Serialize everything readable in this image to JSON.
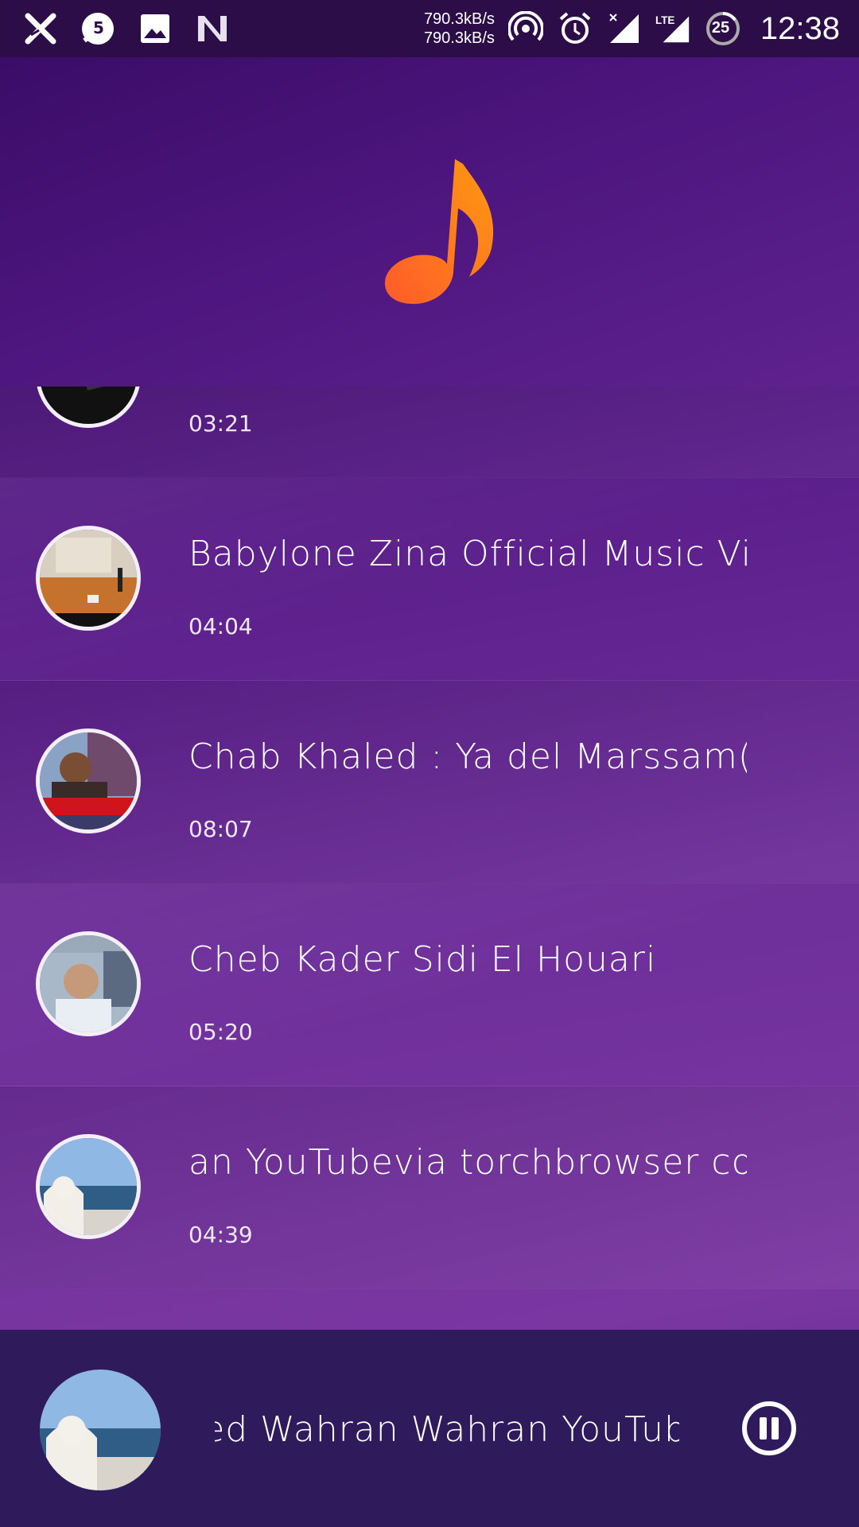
{
  "status_bar": {
    "net_up": "790.3kB/s",
    "net_down": "790.3kB/s",
    "notification_badge": "5",
    "battery_level": "25",
    "time": "12:38"
  },
  "tracks": [
    {
      "title": "",
      "duration": "03:21"
    },
    {
      "title": "Babylone Zina Official Music Vic",
      "duration": "04:04"
    },
    {
      "title": "Chab Khaled : Ya del Marssam(",
      "duration": "08:07"
    },
    {
      "title": "Cheb Kader Sidi El Houari",
      "duration": "05:20"
    },
    {
      "title": "an YouTubevia torchbrowser cor",
      "duration": "04:39"
    }
  ],
  "now_playing": {
    "title": "aled Wahran Wahran YouTube"
  },
  "colors": {
    "accent": "#ff7a1a",
    "header": "#4d157e",
    "player_bar": "#2f1a5c"
  }
}
